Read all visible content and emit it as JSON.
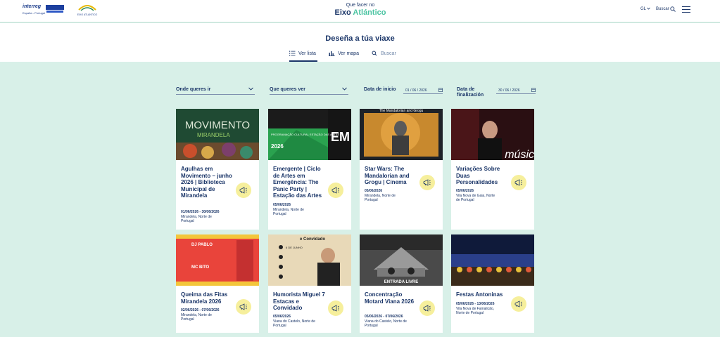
{
  "header": {
    "logo_left_text": "interreg",
    "logo_left_sub": "España - Portugal",
    "logo_right_text": "EIXO ATLÁNTICO",
    "site_sub": "Que facer no",
    "site_main": "Eixo",
    "site_accent": "Atlántico",
    "lang": "GL",
    "search_label": "Buscar"
  },
  "plan": {
    "title": "Deseña a túa viaxe",
    "tabs": [
      {
        "label": "Ver lista",
        "icon": "list-icon"
      },
      {
        "label": "Ver mapa",
        "icon": "map-icon"
      },
      {
        "label": "Buscar",
        "icon": "search-icon"
      }
    ]
  },
  "filters": {
    "where": "Onde queres ir",
    "what": "Que queres ver",
    "start_label": "Data de inicio",
    "start_value": "01 / 06 / 2026",
    "end_label_1": "Data de",
    "end_label_2": "finalización",
    "end_value": "30 / 06 / 2026"
  },
  "events": [
    {
      "title": "Agulhas em Movimento – junho 2026 | Biblioteca Municipal de Mirandela",
      "date": "01/06/2026 - 30/06/2026",
      "location": "Mirandela, Norte de Portugal",
      "img_text1": "MOVIMENTO",
      "img_text2": "MIRANDELA"
    },
    {
      "title": "Emergente | Ciclo de Artes em Emergência: The Panic Party | Estação das Artes",
      "date": "05/06/2026",
      "location": "Mirandela, Norte de Portugal",
      "img_text1": "PROGRAMAÇÃO CULTURAL ESTAÇÃO DAS ARTES",
      "img_text2": "2026"
    },
    {
      "title": "Star Wars: The Mandalorian and Grogu | Cinema",
      "date": "05/06/2026",
      "location": "Mirandela, Norte de Portugal",
      "img_text1": "The Mandalorian and Grogu",
      "img_text2": ""
    },
    {
      "title": "Variações Sobre Duas Personalidades",
      "date": "05/06/2026",
      "location": "Vila Nova de Gaia, Norte de Portugal",
      "img_text1": "músic",
      "img_text2": ""
    },
    {
      "title": "Queima das Fitas Mirandela 2026",
      "date": "02/06/2026 - 07/06/2026",
      "location": "Mirandela, Norte de Portugal",
      "img_text1": "DJ PABLO",
      "img_text2": "MC BITO"
    },
    {
      "title": "Humorista Miguel 7 Estacas e Convidado",
      "date": "05/06/2026",
      "location": "Viana do Castelo, Norte de Portugal",
      "img_text1": "e Convidado",
      "img_text2": "6 DE JUNHO"
    },
    {
      "title": "Concentração Motard Viana 2026",
      "date": "05/06/2026 - 07/06/2026",
      "location": "Viana do Castelo, Norte de Portugal",
      "img_text1": "ENTRADA LIVRE",
      "img_text2": ""
    },
    {
      "title": "Festas Antoninas",
      "date": "05/06/2026 - 13/06/2026",
      "location": "Vila Nova de Famalicão, Norte de Portugal",
      "img_text1": "",
      "img_text2": ""
    }
  ],
  "colors": {
    "navy": "#1a3568",
    "mint": "#d8f0e8",
    "accent": "#49c3a1",
    "badge": "#f6ef9c"
  }
}
